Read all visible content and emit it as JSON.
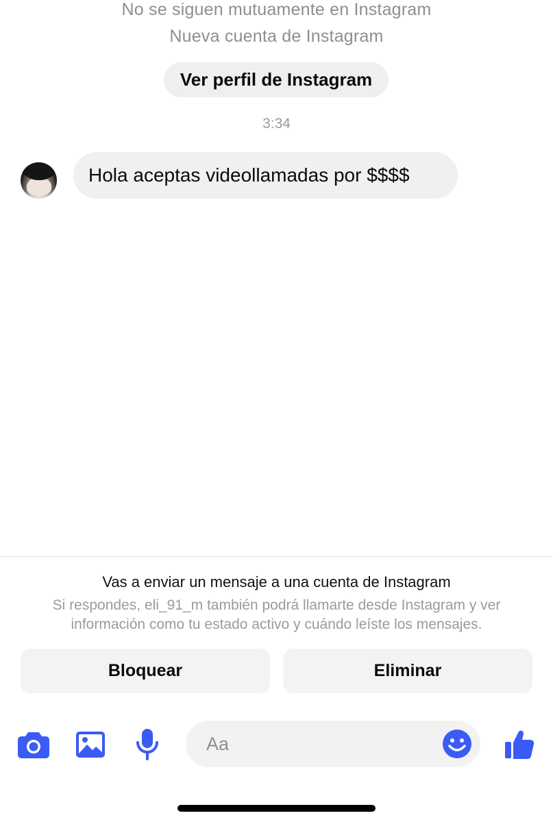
{
  "header": {
    "mutual_text": "No se siguen mutuamente en Instagram",
    "account_text": "Nueva cuenta de Instagram",
    "profile_button_label": "Ver perfil de Instagram"
  },
  "conversation": {
    "timestamp": "3:34",
    "messages": [
      {
        "text": "Hola aceptas videollamadas por $$$$"
      }
    ]
  },
  "notice": {
    "title": "Vas a enviar un mensaje a una cuenta de Instagram",
    "body": "Si respondes, eli_91_m también podrá llamarte desde Instagram y ver información como tu estado activo y cuándo leíste los mensajes."
  },
  "actions": {
    "block_label": "Bloquear",
    "delete_label": "Eliminar"
  },
  "composer": {
    "placeholder": "Aa",
    "icons": [
      "camera-icon",
      "gallery-icon",
      "microphone-icon",
      "emoji-icon",
      "thumbs-up-icon"
    ]
  },
  "colors": {
    "accent": "#3b5bf5",
    "bubble_bg": "#f0f0f0",
    "muted_text": "#8e8e93"
  }
}
